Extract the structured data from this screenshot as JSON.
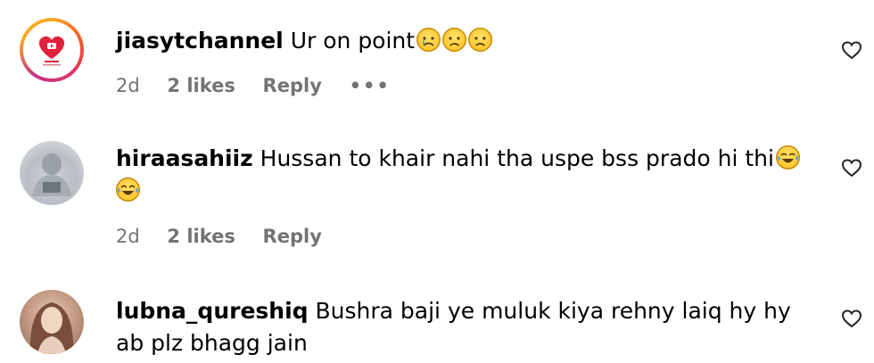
{
  "comments": [
    {
      "username": "jiasytchannel",
      "text": "Ur on point",
      "emojis": [
        "crying-face",
        "sad-face",
        "sad-face"
      ],
      "time": "2d",
      "likes": "2 likes",
      "reply": "Reply",
      "more": "•••",
      "avatar_icon": "jias-yt-channel-logo"
    },
    {
      "username": "hiraasahiiz",
      "text": "Hussan to khair nahi tha uspe bss prado hi thi",
      "emojis": [
        "tears-of-joy-face",
        "tears-of-joy-face"
      ],
      "time": "2d",
      "likes": "2 likes",
      "reply": "Reply",
      "avatar_icon": "user-photo"
    },
    {
      "username": "lubna_qureshiq",
      "text": "Bushra baji ye muluk kiya rehny laiq hy hy ab plz bhagg jain",
      "time": "",
      "likes": "",
      "reply": "",
      "avatar_icon": "user-photo"
    }
  ],
  "colors": {
    "meta_gray": "#737373",
    "text": "#000000",
    "background": "#ffffff"
  }
}
